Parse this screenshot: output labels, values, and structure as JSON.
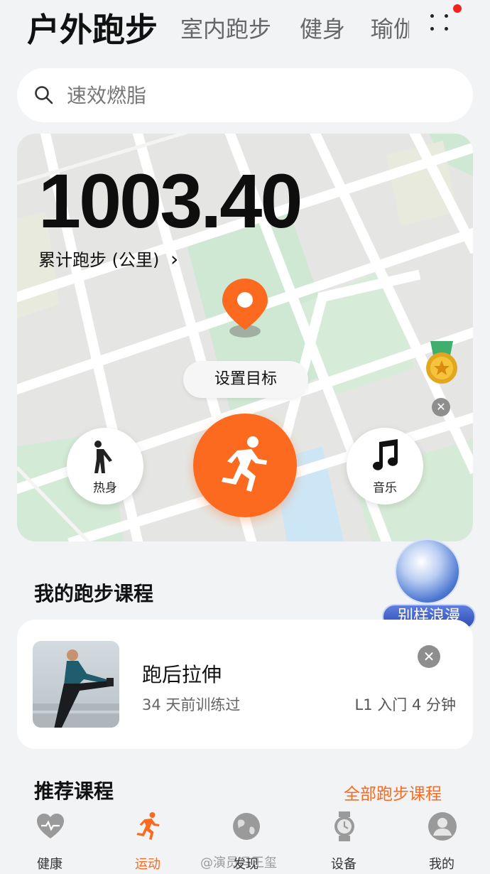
{
  "tabs": [
    {
      "label": "户外跑步",
      "active": true
    },
    {
      "label": "室内跑步"
    },
    {
      "label": "健身"
    },
    {
      "label": "瑜伽"
    }
  ],
  "search": {
    "placeholder": "速效燃脂"
  },
  "stats": {
    "total_distance": "1003.40",
    "distance_label": "累计跑步 (公里)",
    "chevron": "›"
  },
  "map_controls": {
    "set_goal": "设置目标",
    "warmup_label": "热身",
    "music_label": "音乐",
    "close_glyph": "✕"
  },
  "badge": {
    "label": "别样浪漫"
  },
  "my_courses": {
    "title": "我的跑步课程",
    "items": [
      {
        "name": "跑后拉伸",
        "last_trained": "34 天前训练过",
        "level": "L1 入门 4 分钟"
      }
    ]
  },
  "recommended": {
    "title": "推荐课程",
    "all_link": "全部跑步课程"
  },
  "bottom_nav": [
    {
      "label": "健康",
      "icon": "heart-icon"
    },
    {
      "label": "运动",
      "icon": "running-icon",
      "active": true
    },
    {
      "label": "发现",
      "icon": "globe-icon"
    },
    {
      "label": "设备",
      "icon": "watch-icon"
    },
    {
      "label": "我的",
      "icon": "profile-icon"
    }
  ],
  "watermark": "@演员冯王玺",
  "colors": {
    "accent": "#fc6a1f",
    "map_green": "#cfe8d4",
    "map_water": "#cde6f5"
  }
}
